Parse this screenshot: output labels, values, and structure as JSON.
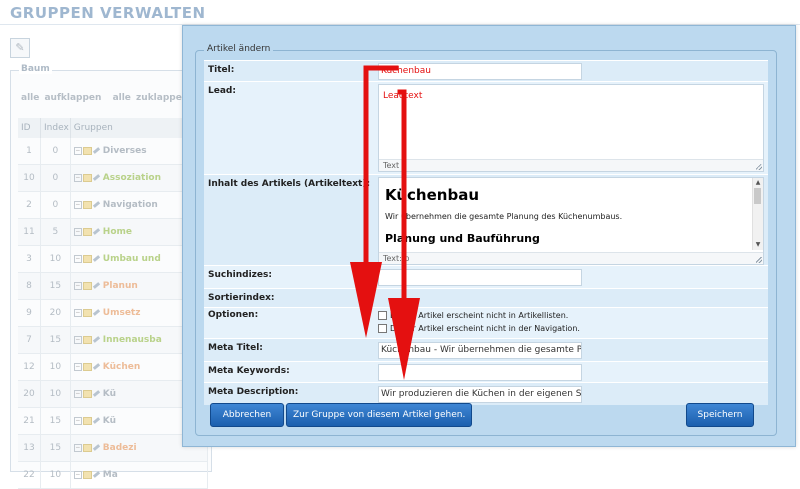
{
  "page": {
    "title": "GRUPPEN VERWALTEN",
    "tool_icon": "✎"
  },
  "tree": {
    "legend": "Baum",
    "expand_all": "alle aufklappen",
    "collapse_all": "alle zuklappen",
    "headers": [
      "ID",
      "Index",
      "Gruppen"
    ],
    "rows": [
      {
        "id": "1",
        "index": "0",
        "name": "Diverses",
        "color": "grey"
      },
      {
        "id": "10",
        "index": "0",
        "name": "Assoziation",
        "color": "green"
      },
      {
        "id": "2",
        "index": "0",
        "name": "Navigation",
        "color": "grey"
      },
      {
        "id": "11",
        "index": "5",
        "name": "Home",
        "color": "green"
      },
      {
        "id": "3",
        "index": "10",
        "name": "Umbau und",
        "color": "green"
      },
      {
        "id": "8",
        "index": "15",
        "name": "Planun",
        "color": "orange"
      },
      {
        "id": "9",
        "index": "20",
        "name": "Umsetz",
        "color": "orange"
      },
      {
        "id": "7",
        "index": "15",
        "name": "Innenausba",
        "color": "green"
      },
      {
        "id": "12",
        "index": "10",
        "name": "Küchen",
        "color": "orange"
      },
      {
        "id": "20",
        "index": "10",
        "name": "Kü",
        "color": "grey"
      },
      {
        "id": "21",
        "index": "15",
        "name": "Kü",
        "color": "grey"
      },
      {
        "id": "13",
        "index": "15",
        "name": "Badezi",
        "color": "orange"
      },
      {
        "id": "22",
        "index": "10",
        "name": "Ma",
        "color": "grey"
      }
    ]
  },
  "modal": {
    "legend": "Artikel ändern",
    "fields": {
      "title_label": "Titel:",
      "title_value": "Küchenbau",
      "lead_label": "Lead:",
      "lead_value": "Leadtext",
      "lead_status": "Text",
      "body_label": "Inhalt des Artikels (Artikeltext):",
      "body_heading": "Küchenbau",
      "body_paragraph": "Wir übernehmen die gesamte Planung des Küchenumbaus.",
      "body_subheading": "Planung und Bauführung",
      "body_status": "Text: p",
      "search_label": "Suchindizes:",
      "search_value": "",
      "sort_label": "Sortierindex:",
      "sort_value": "",
      "options_label": "Optionen:",
      "option_1": "Dieser Artikel erscheint nicht in Artikellisten.",
      "option_2": "Dieser Artikel erscheint nicht in der Navigation.",
      "meta_title_label": "Meta Titel:",
      "meta_title_value": "Küchenbau - Wir übernehmen die gesamte Planung",
      "meta_keywords_label": "Meta Keywords:",
      "meta_keywords_value": "",
      "meta_description_label": "Meta Description:",
      "meta_description_value": "Wir produzieren die Küchen in der eigenen Schreinerei"
    },
    "buttons": {
      "cancel": "Abbrechen",
      "goto_group": "Zur Gruppe von diesem Artikel gehen.",
      "save": "Speichern"
    }
  },
  "colors": {
    "accent_button": "#1b5fae",
    "modal_bg": "#bcd9ef",
    "annotation_red": "#e41010"
  }
}
